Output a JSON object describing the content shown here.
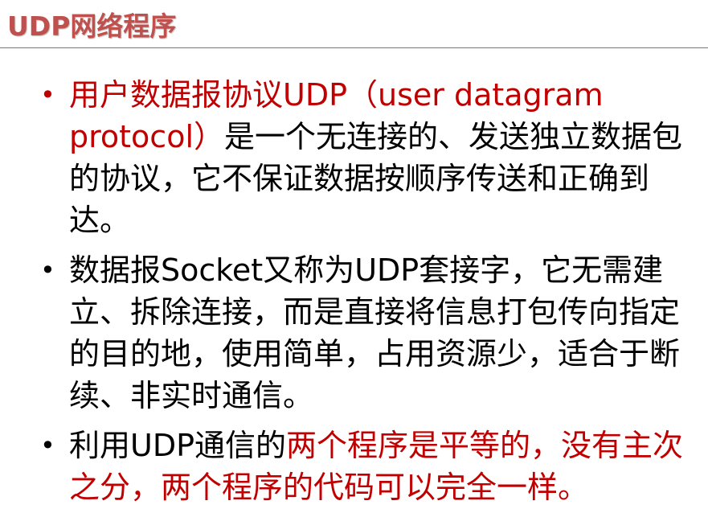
{
  "title": "UDP网络程序",
  "bullets": [
    {
      "marker": "•",
      "marker_color": "#c00000",
      "parts": [
        {
          "text": "用户数据报协议UDP（user datagram protocol）",
          "color": "red"
        },
        {
          "text": "是一个无连接的、发送独立数据包的协议，它不保证数据按顺序传送和正确到达。",
          "color": "black"
        }
      ]
    },
    {
      "marker": "•",
      "marker_color": "#000000",
      "parts": [
        {
          "text": "数据报Socket又称为UDP套接字，它无需建立、拆除连接，而是直接将信息打包传向指定的目的地，使用简单，占用资源少，适合于断续、非实时通信。",
          "color": "black"
        }
      ]
    },
    {
      "marker": "•",
      "marker_color": "#000000",
      "parts": [
        {
          "text": "利用UDP通信的",
          "color": "black"
        },
        {
          "text": "两个程序是平等的，没有主次之分，两个程序的代码可以完全一样。",
          "color": "red"
        }
      ]
    }
  ],
  "colors": {
    "title": "#c0504d",
    "accent_red": "#c00000",
    "divider": "#4f81bd"
  }
}
